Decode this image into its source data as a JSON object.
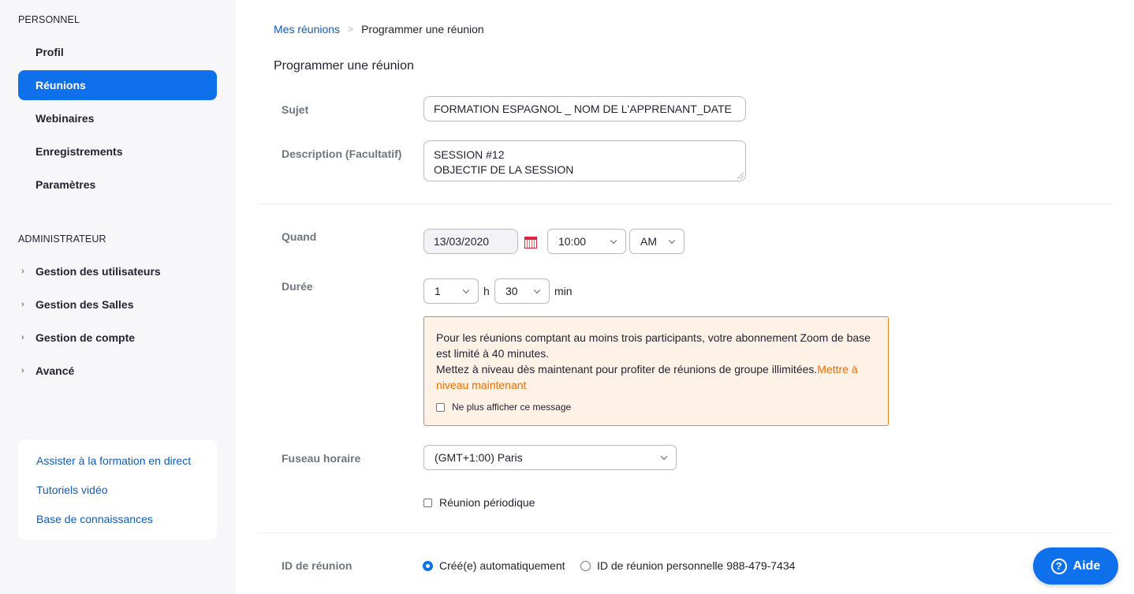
{
  "sidebar": {
    "personal_title": "PERSONNEL",
    "personal_items": [
      {
        "label": "Profil"
      },
      {
        "label": "Réunions"
      },
      {
        "label": "Webinaires"
      },
      {
        "label": "Enregistrements"
      },
      {
        "label": "Paramètres"
      }
    ],
    "admin_title": "ADMINISTRATEUR",
    "admin_items": [
      {
        "label": "Gestion des utilisateurs"
      },
      {
        "label": "Gestion des Salles"
      },
      {
        "label": "Gestion de compte"
      },
      {
        "label": "Avancé"
      }
    ],
    "help_links": [
      {
        "label": "Assister à la formation en direct"
      },
      {
        "label": "Tutoriels vidéo"
      },
      {
        "label": "Base de connaissances"
      }
    ]
  },
  "breadcrumb": {
    "parent": "Mes réunions",
    "separator": ">",
    "current": "Programmer une réunion"
  },
  "page_title": "Programmer une réunion",
  "form": {
    "subject_label": "Sujet",
    "subject_value": "FORMATION ESPAGNOL _ NOM DE L'APPRENANT_DATE",
    "description_label": "Description (Facultatif)",
    "description_line1": "SESSION #12",
    "description_line2": "OBJECTIF DE LA SESSION",
    "when_label": "Quand",
    "date_value": "13/03/2020",
    "time_value": "10:00",
    "ampm_value": "AM",
    "duration_label": "Durée",
    "hours_value": "1",
    "hours_unit": "h",
    "minutes_value": "30",
    "minutes_unit": "min",
    "warning": {
      "text1": "Pour les réunions comptant au moins trois participants, votre abonnement Zoom de base",
      "text2": "est limité à 40 minutes.",
      "text3": "Mettez à niveau dès maintenant pour profiter de réunions de groupe illimitées.",
      "link_part1": "Mettre à",
      "link_part2": "niveau maintenant",
      "checkbox_label": "Ne plus afficher ce message"
    },
    "timezone_label": "Fuseau horaire",
    "timezone_value": "(GMT+1:00) Paris",
    "recurring_label": "Réunion périodique",
    "meeting_id_label": "ID de réunion",
    "auto_id_label": "Créé(e) automatiquement",
    "personal_id_label": "ID de réunion personnelle 988-479-7434"
  },
  "help_button": {
    "label": "Aide"
  },
  "colors": {
    "accent": "#0e71eb",
    "warning_border": "#f48019",
    "warning_bg": "#fef1e6",
    "link_orange": "#f26d00"
  }
}
